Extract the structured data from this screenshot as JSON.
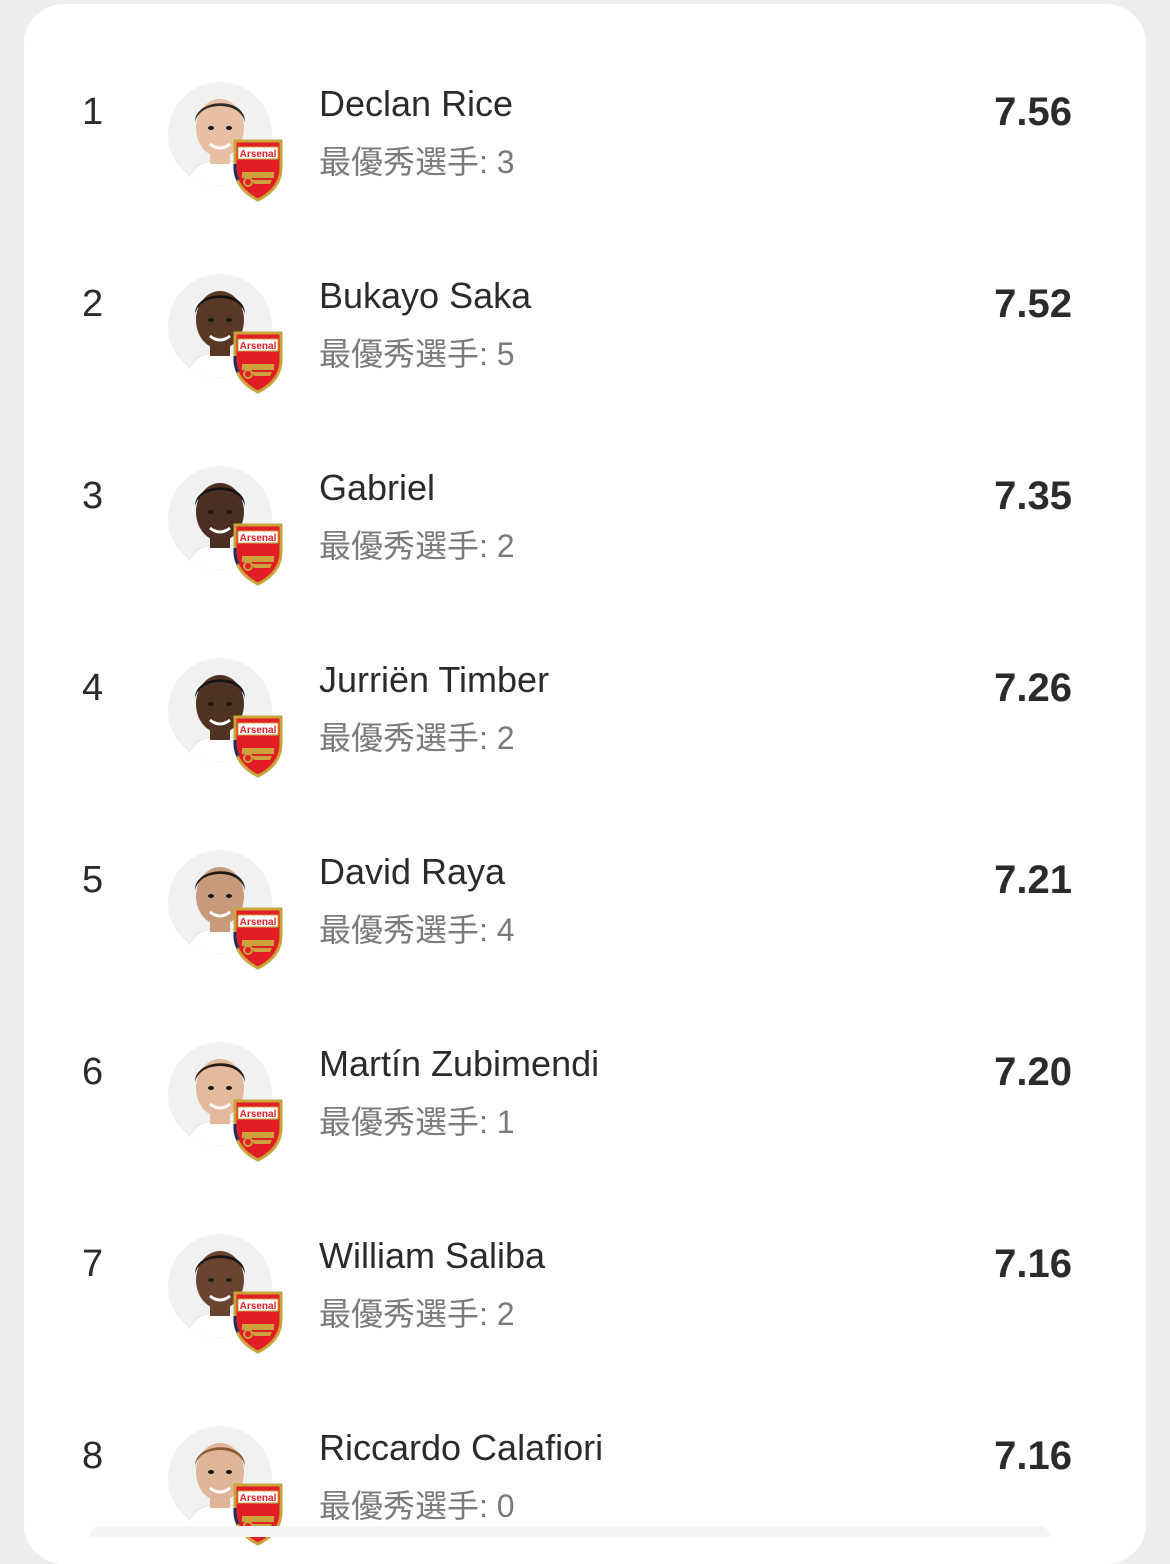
{
  "colors": {
    "card_bg": "#ffffff",
    "page_bg": "#eeeeee",
    "text_primary": "#2b2b2b",
    "text_secondary": "#7a7a7a",
    "badge_red": "#e21d26",
    "badge_gold": "#c9a43a",
    "badge_navy": "#1c2e5a"
  },
  "badge": {
    "label": "Arsenal",
    "icon": "arsenal-crest-icon"
  },
  "stat_label": "最優秀選手: ",
  "players": [
    {
      "rank": "1",
      "name": "Declan Rice",
      "motm": "3",
      "rating": "7.56",
      "skin": "#e8bfa3",
      "hair": "#2a2a2a"
    },
    {
      "rank": "2",
      "name": "Bukayo Saka",
      "motm": "5",
      "rating": "7.52",
      "skin": "#5a3826",
      "hair": "#141414"
    },
    {
      "rank": "3",
      "name": "Gabriel",
      "motm": "2",
      "rating": "7.35",
      "skin": "#4a2f22",
      "hair": "#121212"
    },
    {
      "rank": "4",
      "name": "Jurriën Timber",
      "motm": "2",
      "rating": "7.26",
      "skin": "#4e3223",
      "hair": "#141414"
    },
    {
      "rank": "5",
      "name": "David Raya",
      "motm": "4",
      "rating": "7.21",
      "skin": "#c79a7c",
      "hair": "#1e1a17"
    },
    {
      "rank": "6",
      "name": "Martín Zubimendi",
      "motm": "1",
      "rating": "7.20",
      "skin": "#e3b89b",
      "hair": "#231b16"
    },
    {
      "rank": "7",
      "name": "William Saliba",
      "motm": "2",
      "rating": "7.16",
      "skin": "#6a4430",
      "hair": "#161616"
    },
    {
      "rank": "8",
      "name": "Riccardo Calafiori",
      "motm": "0",
      "rating": "7.16",
      "skin": "#e0b497",
      "hair": "#8a5a33"
    }
  ]
}
